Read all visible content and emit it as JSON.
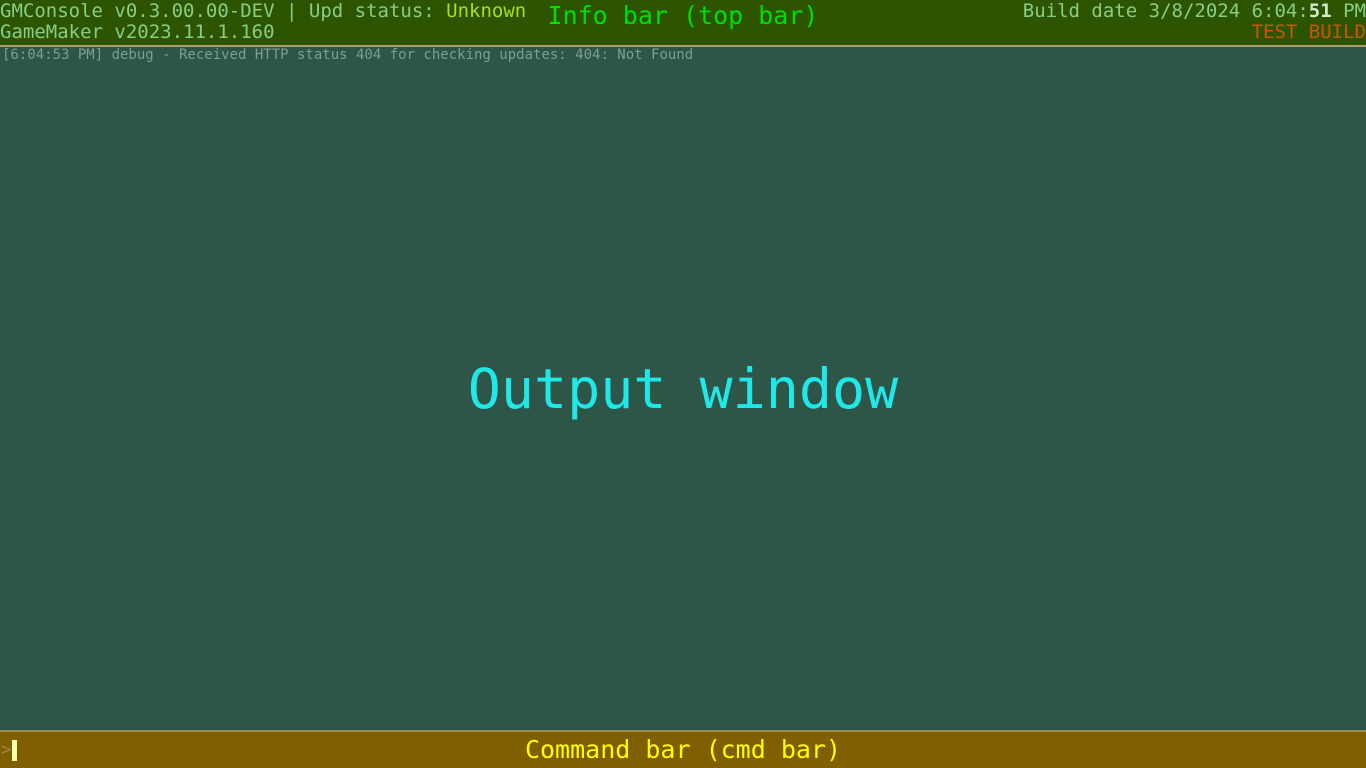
{
  "colors": {
    "top_bar_bg": "#2d5500",
    "output_bg": "#2d5548",
    "cmd_bar_bg": "#7f5f00",
    "separator": "#a89a6a",
    "top_text": "#88cc88",
    "upd_status": "#aadd22",
    "info_bar_label": "#00e000",
    "test_build": "#cc5500",
    "log_text": "#7e9e92",
    "output_label": "#1fe8e8",
    "cmd_label": "#ffff00",
    "caret": "#ffffaa"
  },
  "top_bar": {
    "app_title": "GMConsole v0.3.00.00-DEV",
    "separator_pipe": " | ",
    "upd_status_label": "Upd status: ",
    "upd_status_value": "Unknown",
    "engine_version": "GameMaker v2023.11.1.160",
    "center_label": "Info bar (top bar)",
    "build_date_prefix": "Build date 3/8/2024 6:04:",
    "build_date_seconds": "51",
    "build_date_suffix": " PM",
    "build_tag": "TEST BUILD"
  },
  "output_window": {
    "label": "Output window",
    "log_lines": [
      "[6:04:53 PM] debug - Received HTTP status 404 for checking updates: 404: Not Found"
    ]
  },
  "command_bar": {
    "prompt_symbol": ">",
    "input_value": "",
    "input_placeholder": "",
    "label": "Command bar (cmd bar)"
  }
}
